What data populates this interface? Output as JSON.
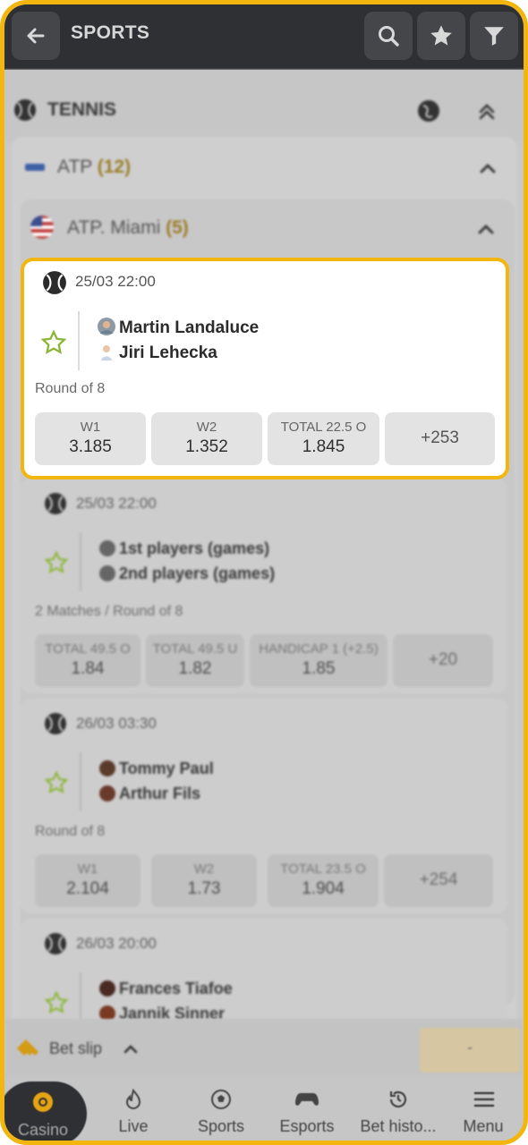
{
  "header": {
    "title": "SPORTS",
    "back_icon": "arrow-left-icon"
  },
  "section": {
    "sport": "TENNIS"
  },
  "tournament_group": {
    "name": "ATP",
    "count": "(12)"
  },
  "tournament": {
    "name": "ATP. Miami",
    "count": "(5)"
  },
  "matches": [
    {
      "datetime": "25/03 22:00",
      "player1": "Martin Landaluce",
      "player2": "Jiri Lehecka",
      "round": "Round of 8",
      "odds": [
        {
          "label": "W1",
          "value": "3.185"
        },
        {
          "label": "W2",
          "value": "1.352"
        },
        {
          "label": "TOTAL 22.5 O",
          "value": "1.845"
        }
      ],
      "more": "+253"
    },
    {
      "datetime": "25/03 22:00",
      "player1": "1st players (games)",
      "player2": "2nd players (games)",
      "round": "2 Matches / Round of 8",
      "odds": [
        {
          "label": "TOTAL 49.5 O",
          "value": "1.84"
        },
        {
          "label": "TOTAL 49.5 U",
          "value": "1.82"
        },
        {
          "label": "HANDICAP 1 (+2.5)",
          "value": "1.85"
        }
      ],
      "more": "+20"
    },
    {
      "datetime": "26/03 03:30",
      "player1": "Tommy Paul",
      "player2": "Arthur Fils",
      "round": "Round of 8",
      "odds": [
        {
          "label": "W1",
          "value": "2.104"
        },
        {
          "label": "W2",
          "value": "1.73"
        },
        {
          "label": "TOTAL 23.5 O",
          "value": "1.904"
        }
      ],
      "more": "+254"
    },
    {
      "datetime": "26/03 20:00",
      "player1": "Frances Tiafoe",
      "player2": "Jannik Sinner"
    }
  ],
  "betslip": {
    "label": "Bet slip",
    "value": "-"
  },
  "nav": {
    "casino": "Casino",
    "live": "Live",
    "sports": "Sports",
    "esports": "Esports",
    "history": "Bet histo...",
    "menu": "Menu"
  },
  "colors": {
    "accent": "#f2b60f",
    "dark": "#2f3033"
  }
}
